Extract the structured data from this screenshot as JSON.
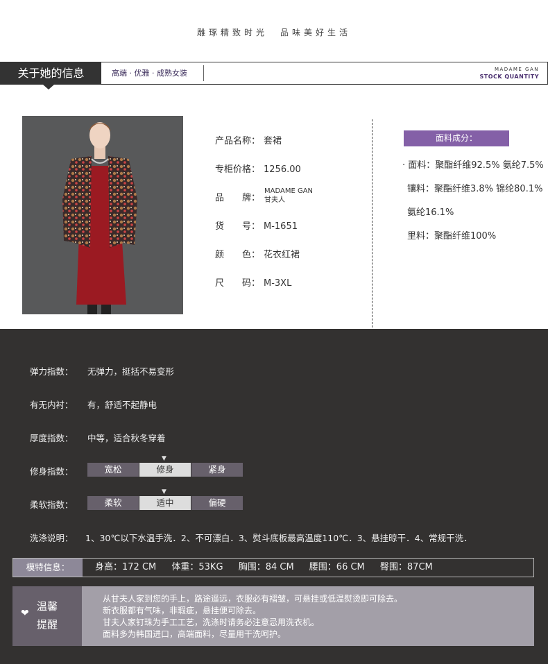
{
  "slogan": {
    "left": "雕琢精致时光",
    "right": "品味美好生活"
  },
  "header": {
    "tab_label": "关于她的信息",
    "subtitle": "高端 · 优雅 · 成熟女装",
    "brand_line1": "MADAME GAN",
    "brand_line2": "STOCK QUANTITY"
  },
  "product": {
    "name_label": "产品名称：",
    "name_value": "套裙",
    "price_label": "专柜价格：",
    "price_value": "1256.00",
    "brand_label": "品　　牌：",
    "brand_value_en": "MADAME GAN",
    "brand_value_cn": "甘夫人",
    "sku_label": "货　　号：",
    "sku_value": "M-1651",
    "color_label": "颜　　色：",
    "color_value": "花衣红裙",
    "size_label": "尺　　码：",
    "size_value": "M-3XL"
  },
  "fabric": {
    "title": "面料成分：",
    "lines": [
      "· 面料：聚酯纤维92.5% 氨纶7.5%",
      "镶料：聚酯纤维3.8% 锦纶80.1%",
      "氨纶16.1%",
      "里料：聚酯纤维100%"
    ]
  },
  "attributes": {
    "elasticity_label": "弹力指数：",
    "elasticity_value": "无弹力，挺括不易变形",
    "lining_label": "有无内衬：",
    "lining_value": "有，舒适不起静电",
    "thickness_label": "厚度指数：",
    "thickness_value": "中等，适合秋冬穿着",
    "fit_label": "修身指数：",
    "fit_options": [
      "宽松",
      "修身",
      "紧身"
    ],
    "fit_selected": 1,
    "softness_label": "柔软指数：",
    "softness_options": [
      "柔软",
      "适中",
      "偏硬"
    ],
    "softness_selected": 1,
    "wash_label": "洗涤说明：",
    "wash_value": "1、30℃以下水温手洗．2、不可漂白．3、熨斗底板最高温度110℃．3、悬挂晾干．4、常规干洗．",
    "marker": "▼"
  },
  "model": {
    "label": "模特信息：",
    "height": "身高：172 CM",
    "weight": "体重：53KG",
    "bust": "胸围：84 CM",
    "waist": "腰围：66 CM",
    "hip": "臀围：87CM"
  },
  "notice": {
    "icon": "heart-icon",
    "title1": "温馨",
    "title2": "提醒",
    "lines": [
      "从甘夫人家到您的手上，路途遥远，衣服必有褶皱，可悬挂或低温熨烫即可除去。",
      "新衣服都有气味，非瑕疵，悬挂便可除去。",
      "甘夫人家钉珠为手工工艺，洗涤时请务必注意忌用洗衣机。",
      "面料多为韩国进口，高端面料，尽量用干洗呵护。"
    ]
  },
  "colors": {
    "accent": "#8460a7",
    "dark_bg": "#333130",
    "brand": "#4a2f6f"
  }
}
